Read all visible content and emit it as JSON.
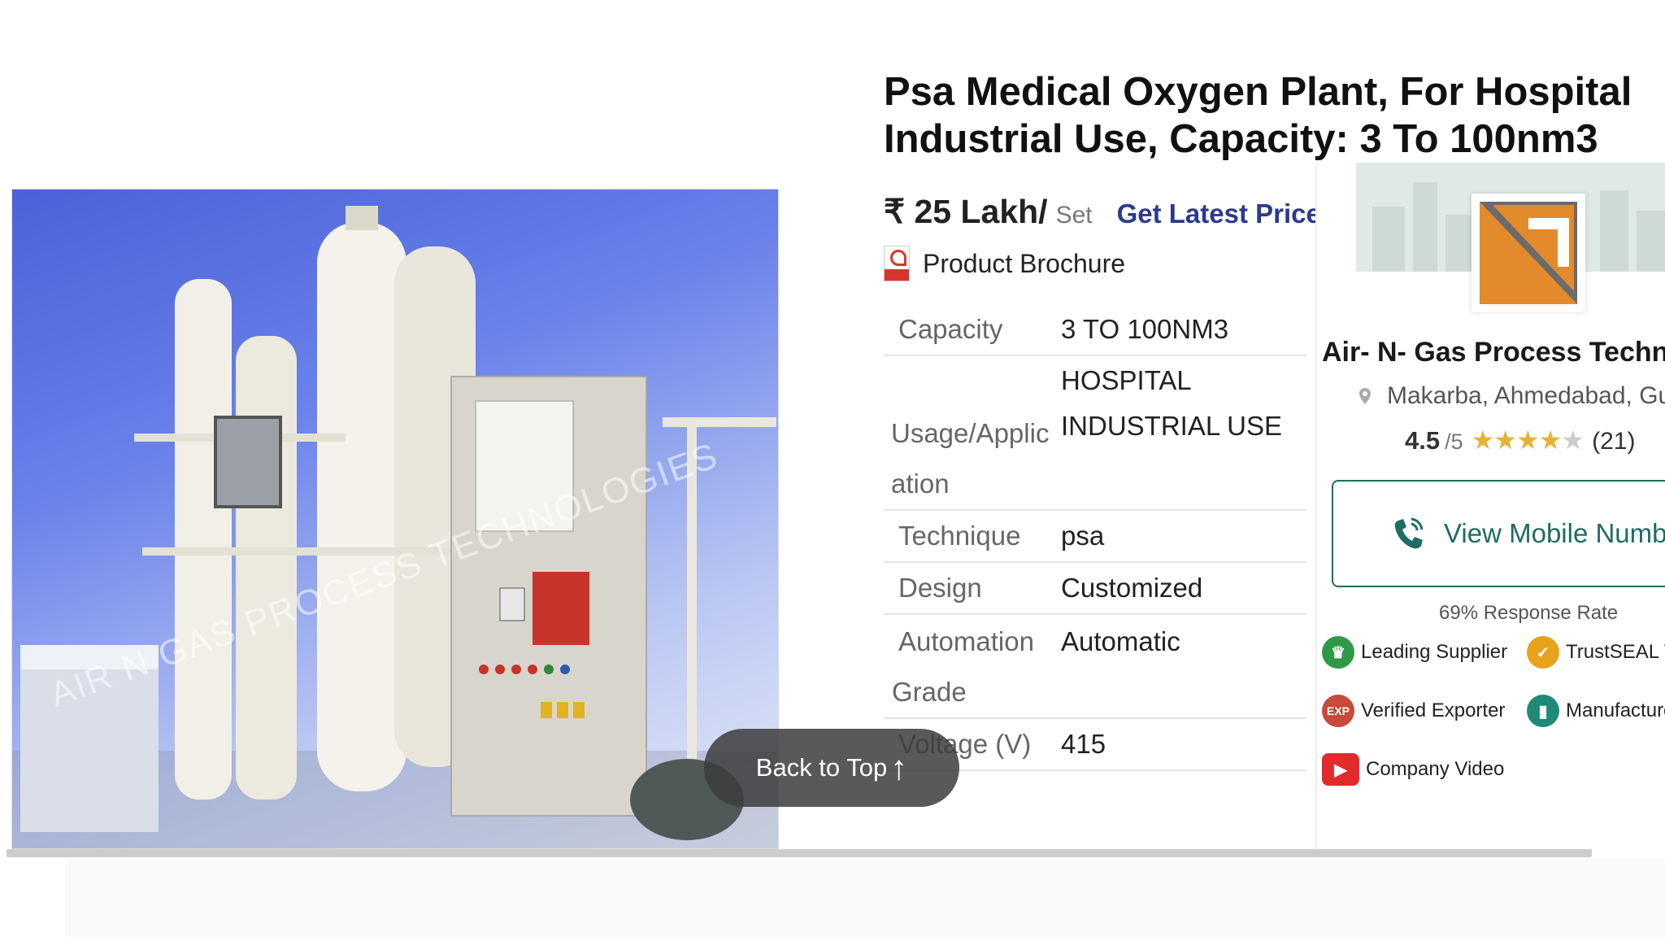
{
  "product": {
    "title": "Psa Medical Oxygen Plant, For Hospital Industrial Use, Capacity: 3 To 100nm3",
    "image_alt": "Oxygen plant image",
    "watermark": "AIR N GAS PROCESS TECHNOLOGIES",
    "price": "₹ 25 Lakh/",
    "price_unit": "Set",
    "get_price_label": "Get Latest Price",
    "brochure_label": "Product Brochure",
    "specs": [
      {
        "key": "Capacity",
        "value": "3 TO 100NM3"
      },
      {
        "key": "Usage/Application",
        "value": "HOSPITAL INDUSTRIAL USE"
      },
      {
        "key": "Technique",
        "value": "psa"
      },
      {
        "key": "Design",
        "value": "Customized"
      },
      {
        "key": "Automation Grade",
        "value": "Automatic"
      },
      {
        "key": "Voltage (V)",
        "value": "415"
      }
    ],
    "spec_lines": {
      "usage_key_1": "Usage/Applic",
      "usage_key_2": "ation",
      "usage_val_1": "HOSPITAL",
      "usage_val_2": "INDUSTRIAL USE",
      "auto_key_1": "Automation",
      "auto_key_2": "Grade"
    }
  },
  "supplier": {
    "name": "Air- N- Gas Process Technolo",
    "location": "Makarba, Ahmedabad, Guja",
    "rating": "4.5",
    "rating_max": "/5",
    "rating_value": 4.5,
    "reviews": "(21)",
    "mobile_label": "View Mobile Number",
    "response_rate": "69% Response Rate",
    "badges": [
      {
        "label": "Leading Supplier",
        "icon": "crown-icon",
        "color": "#2e9a47"
      },
      {
        "label": "TrustSEAL V",
        "icon": "trustseal-icon",
        "color": "#e8a21c"
      },
      {
        "label": "Verified Exporter",
        "icon": "exporter-icon",
        "color": "#c84a3a"
      },
      {
        "label": "Manufacture",
        "icon": "factory-icon",
        "color": "#1e8a78"
      },
      {
        "label": "Company Video",
        "icon": "youtube-icon",
        "color": "#e32b2b"
      }
    ]
  },
  "ui": {
    "back_to_top": "Back to Top",
    "back_to_top_icon": "arrow-up-icon"
  },
  "colors": {
    "title": "#111111",
    "get_price": "#2b3a8c",
    "mobile_accent": "#1e6c63",
    "star": "#e8b23a",
    "logo_orange": "#e38a2c",
    "logo_gray": "#6b6b6b"
  }
}
